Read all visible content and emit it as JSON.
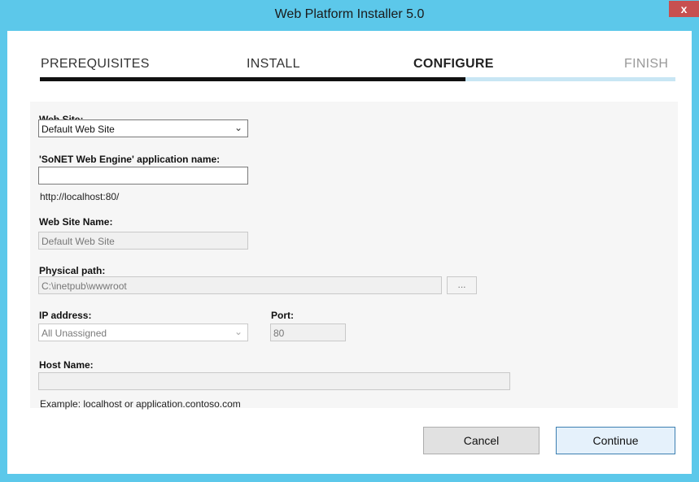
{
  "window": {
    "title": "Web Platform Installer 5.0",
    "close_label": "x"
  },
  "steps": [
    {
      "label": "PREREQUISITES",
      "state": "done"
    },
    {
      "label": "INSTALL",
      "state": "done"
    },
    {
      "label": "CONFIGURE",
      "state": "active"
    },
    {
      "label": "FINISH",
      "state": "pending"
    }
  ],
  "progress": {
    "fraction": 0.67
  },
  "form": {
    "web_site": {
      "label": "Web Site:",
      "value": "Default Web Site"
    },
    "app_name": {
      "label": "'SoNET Web Engine' application name:",
      "value": "",
      "url": "http://localhost:80/"
    },
    "site_name": {
      "label": "Web Site Name:",
      "value": "Default Web Site"
    },
    "physical_path": {
      "label": "Physical path:",
      "value": "C:\\inetpub\\wwwroot",
      "browse_label": "..."
    },
    "ip_address": {
      "label": "IP address:",
      "value": "All Unassigned"
    },
    "port": {
      "label": "Port:",
      "value": "80"
    },
    "host_name": {
      "label": "Host Name:",
      "value": "",
      "example": "Example: localhost or application.contoso.com"
    }
  },
  "buttons": {
    "cancel": "Cancel",
    "continue": "Continue"
  },
  "colors": {
    "title_bar": "#5cc8ea",
    "close": "#c75050",
    "progress_fill": "#111111",
    "progress_track": "#c8e6f4"
  }
}
